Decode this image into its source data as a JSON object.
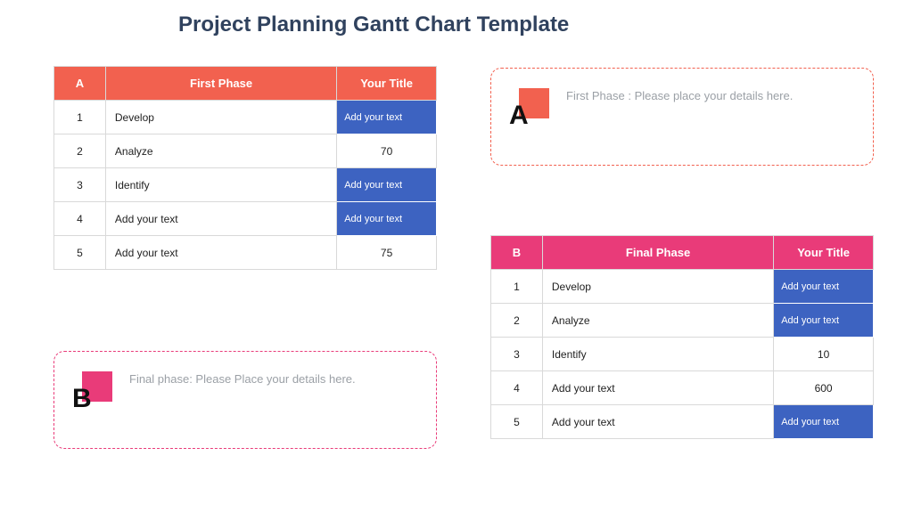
{
  "title": "Project Planning Gantt Chart Template",
  "colors": {
    "a": "#f2614f",
    "b": "#e93b79",
    "blue": "#3d63c1"
  },
  "tableA": {
    "headers": [
      "A",
      "First Phase",
      "Your Title"
    ],
    "rows": [
      {
        "n": "1",
        "label": "Develop",
        "value": "Add your text",
        "blue": true
      },
      {
        "n": "2",
        "label": "Analyze",
        "value": "70",
        "blue": false
      },
      {
        "n": "3",
        "label": "Identify",
        "value": "Add your text",
        "blue": true
      },
      {
        "n": "4",
        "label": "Add your text",
        "value": "Add your text",
        "blue": true
      },
      {
        "n": "5",
        "label": "Add your text",
        "value": "75",
        "blue": false
      }
    ]
  },
  "tableB": {
    "headers": [
      "B",
      "Final Phase",
      "Your Title"
    ],
    "rows": [
      {
        "n": "1",
        "label": "Develop",
        "value": "Add your text",
        "blue": true
      },
      {
        "n": "2",
        "label": "Analyze",
        "value": "Add your text",
        "blue": true
      },
      {
        "n": "3",
        "label": "Identify",
        "value": "10",
        "blue": false
      },
      {
        "n": "4",
        "label": "Add your text",
        "value": "600",
        "blue": false
      },
      {
        "n": "5",
        "label": "Add your text",
        "value": "Add your text",
        "blue": true
      }
    ]
  },
  "noteA": {
    "letter": "A",
    "text": "First Phase : Please place your details here."
  },
  "noteB": {
    "letter": "B",
    "text": "Final phase: Please Place your details here."
  },
  "chart_data": {
    "type": "table",
    "title": "Project Planning Gantt Chart Template",
    "tables": [
      {
        "name": "First Phase",
        "columns": [
          "#",
          "First Phase",
          "Your Title"
        ],
        "rows": [
          [
            "1",
            "Develop",
            "Add your text"
          ],
          [
            "2",
            "Analyze",
            "70"
          ],
          [
            "3",
            "Identify",
            "Add your text"
          ],
          [
            "4",
            "Add your text",
            "Add your text"
          ],
          [
            "5",
            "Add your text",
            "75"
          ]
        ]
      },
      {
        "name": "Final Phase",
        "columns": [
          "#",
          "Final Phase",
          "Your Title"
        ],
        "rows": [
          [
            "1",
            "Develop",
            "Add your text"
          ],
          [
            "2",
            "Analyze",
            "Add your text"
          ],
          [
            "3",
            "Identify",
            "10"
          ],
          [
            "4",
            "Add your text",
            "600"
          ],
          [
            "5",
            "Add your text",
            "Add your text"
          ]
        ]
      }
    ]
  }
}
